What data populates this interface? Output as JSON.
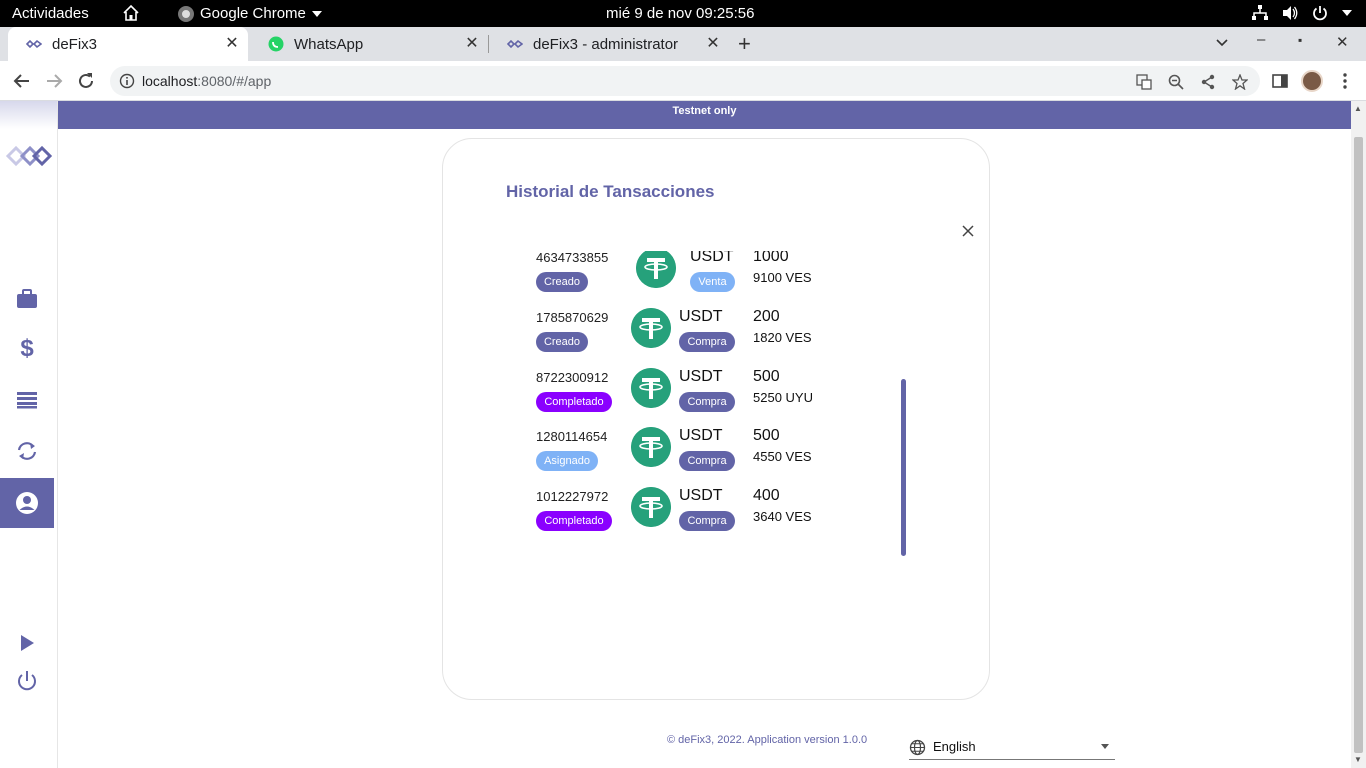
{
  "os": {
    "activities": "Actividades",
    "app_name": "Google Chrome",
    "clock": "mié  9 de nov  09:25:56"
  },
  "browser": {
    "tabs": [
      {
        "label": "deFix3",
        "icon": "defix-icon",
        "active": true
      },
      {
        "label": "WhatsApp",
        "icon": "whatsapp-icon",
        "active": false
      },
      {
        "label": "deFix3 - administrator",
        "icon": "defix-icon",
        "active": false
      }
    ],
    "url_host": "localhost",
    "url_rest": ":8080/#/app"
  },
  "app": {
    "banner": "Testnet only",
    "modal_title": "Historial de Tansacciones",
    "transactions": [
      {
        "id": "4634733855",
        "status": "Creado",
        "status_color": "#6264a7",
        "asset": "USDT",
        "type": "Venta",
        "type_color": "#7fb2f6",
        "amount": "1000",
        "fiat": "9100 VES"
      },
      {
        "id": "1785870629",
        "status": "Creado",
        "status_color": "#6264a7",
        "asset": "USDT",
        "type": "Compra",
        "type_color": "#6264a7",
        "amount": "200",
        "fiat": "1820 VES"
      },
      {
        "id": "8722300912",
        "status": "Completado",
        "status_color": "#8a00ff",
        "asset": "USDT",
        "type": "Compra",
        "type_color": "#6264a7",
        "amount": "500",
        "fiat": "5250 UYU"
      },
      {
        "id": "1280114654",
        "status": "Asignado",
        "status_color": "#7fb2f6",
        "asset": "USDT",
        "type": "Compra",
        "type_color": "#6264a7",
        "amount": "500",
        "fiat": "4550 VES"
      },
      {
        "id": "1012227972",
        "status": "Completado",
        "status_color": "#8a00ff",
        "asset": "USDT",
        "type": "Compra",
        "type_color": "#6264a7",
        "amount": "400",
        "fiat": "3640 VES"
      }
    ],
    "footer": "© deFix3, 2022. Application version 1.0.0",
    "language": "English",
    "accent": "#6264a7"
  }
}
